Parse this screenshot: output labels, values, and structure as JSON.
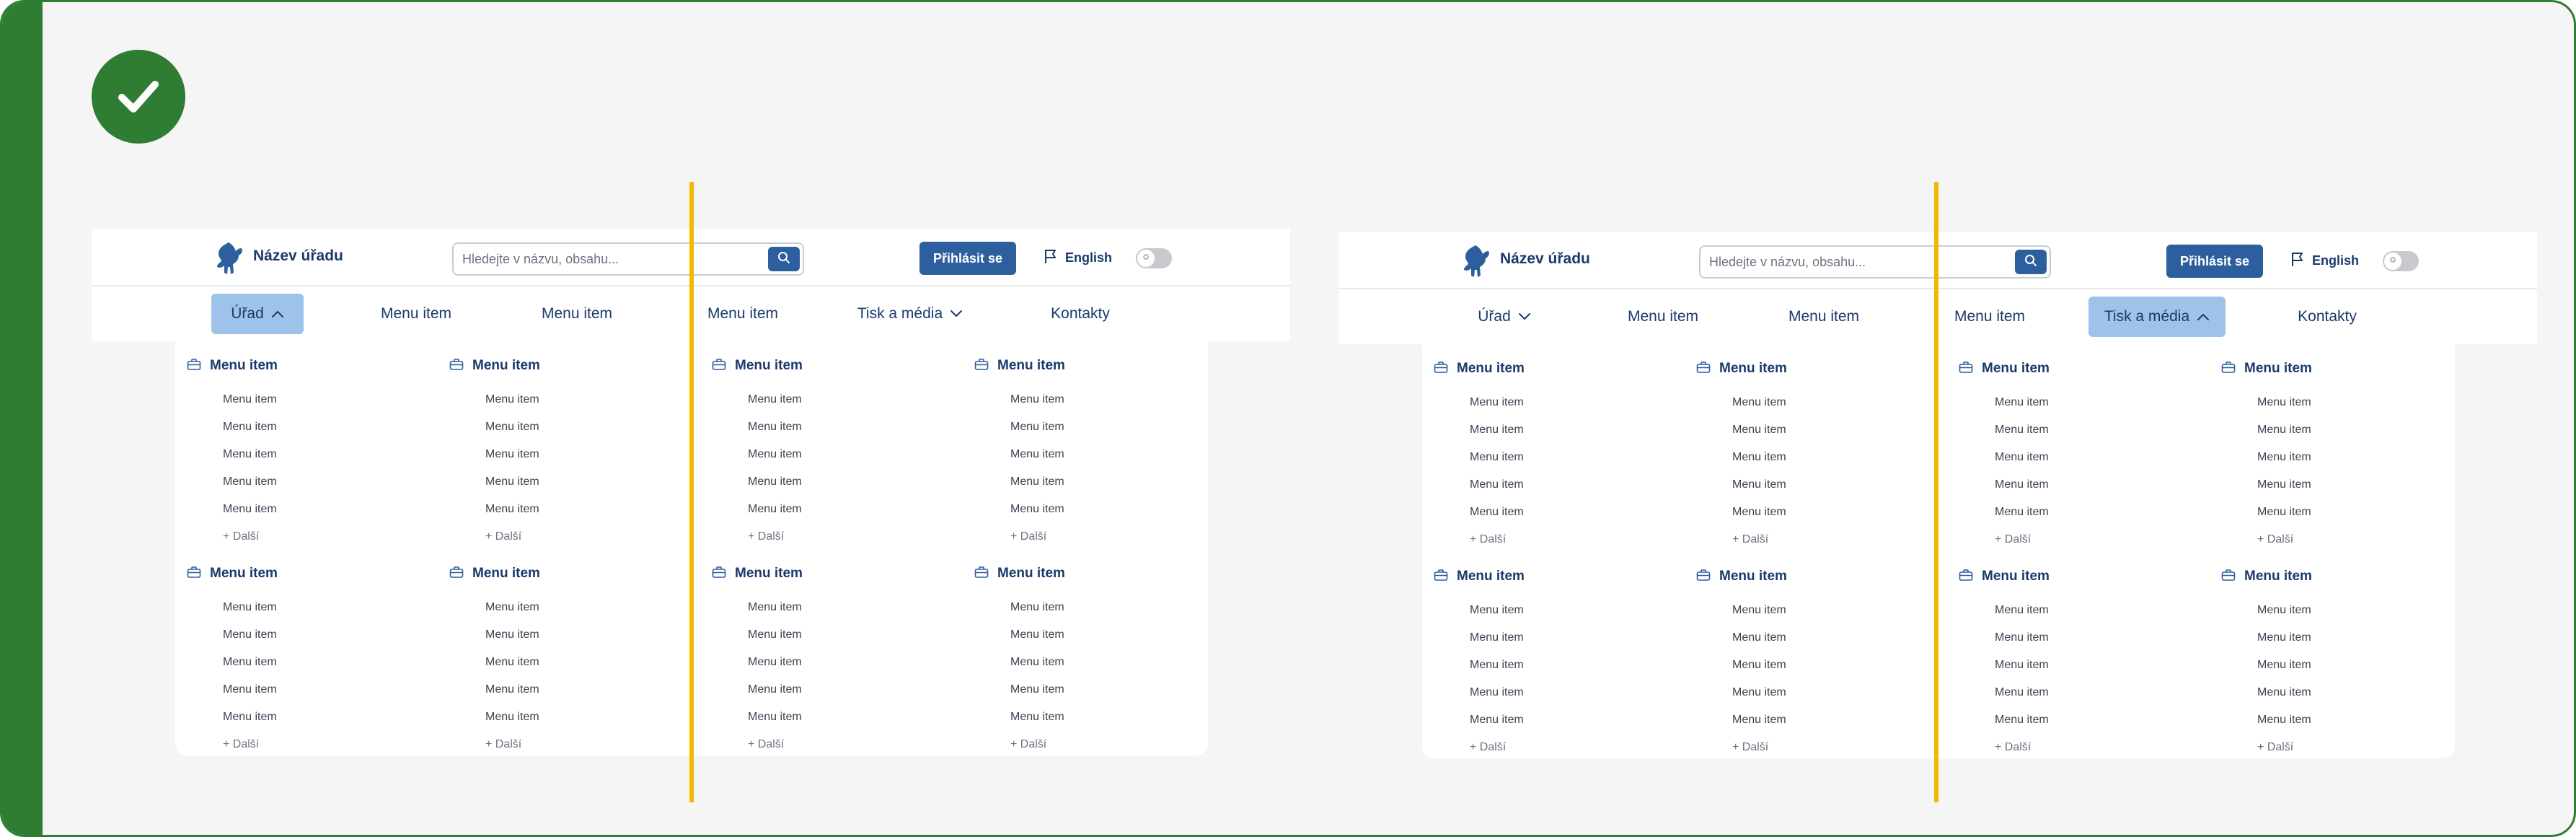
{
  "colors": {
    "frame_green": "#2e7d32",
    "primary": "#2d5f9e",
    "active_nav": "#9ec3ea",
    "guide_yellow": "#f5b800",
    "text_dark": "#1b3a6b"
  },
  "icons": {
    "status": "check-icon",
    "logo": "lion-emblem-icon",
    "search": "search-icon",
    "language": "flag-icon",
    "group": "briefcase-icon",
    "chevron_up": "chevron-up-icon",
    "chevron_down": "chevron-down-icon"
  },
  "examples": [
    {
      "header": {
        "org_name": "Název úřadu",
        "search_placeholder": "Hledejte v názvu, obsahu...",
        "login_label": "Přihlásit se",
        "language_label": "English"
      },
      "nav": [
        {
          "label": "Úřad",
          "chevron": "up",
          "active": true
        },
        {
          "label": "Menu item"
        },
        {
          "label": "Menu item"
        },
        {
          "label": "Menu item"
        },
        {
          "label": "Tisk a média",
          "chevron": "down",
          "active": false
        },
        {
          "label": "Kontakty"
        }
      ],
      "groups": [
        {
          "title": "Menu item",
          "items": [
            "Menu item",
            "Menu item",
            "Menu item",
            "Menu item",
            "Menu item"
          ],
          "more": "+ Další"
        },
        {
          "title": "Menu item",
          "items": [
            "Menu item",
            "Menu item",
            "Menu item",
            "Menu item",
            "Menu item"
          ],
          "more": "+ Další"
        },
        {
          "title": "Menu item",
          "items": [
            "Menu item",
            "Menu item",
            "Menu item",
            "Menu item",
            "Menu item"
          ],
          "more": "+ Další"
        },
        {
          "title": "Menu item",
          "items": [
            "Menu item",
            "Menu item",
            "Menu item",
            "Menu item",
            "Menu item"
          ],
          "more": "+ Další"
        },
        {
          "title": "Menu item",
          "items": [
            "Menu item",
            "Menu item",
            "Menu item",
            "Menu item",
            "Menu item"
          ],
          "more": "+ Další"
        },
        {
          "title": "Menu item",
          "items": [
            "Menu item",
            "Menu item",
            "Menu item",
            "Menu item",
            "Menu item"
          ],
          "more": "+ Další"
        },
        {
          "title": "Menu item",
          "items": [
            "Menu item",
            "Menu item",
            "Menu item",
            "Menu item",
            "Menu item"
          ],
          "more": "+ Další"
        },
        {
          "title": "Menu item",
          "items": [
            "Menu item",
            "Menu item",
            "Menu item",
            "Menu item",
            "Menu item"
          ],
          "more": "+ Další"
        }
      ]
    },
    {
      "header": {
        "org_name": "Název úřadu",
        "search_placeholder": "Hledejte v názvu, obsahu...",
        "login_label": "Přihlásit se",
        "language_label": "English"
      },
      "nav": [
        {
          "label": "Úřad",
          "chevron": "down",
          "active": false
        },
        {
          "label": "Menu item"
        },
        {
          "label": "Menu item"
        },
        {
          "label": "Menu item"
        },
        {
          "label": "Tisk a média",
          "chevron": "up",
          "active": true
        },
        {
          "label": "Kontakty"
        }
      ],
      "groups": [
        {
          "title": "Menu item",
          "items": [
            "Menu item",
            "Menu item",
            "Menu item",
            "Menu item",
            "Menu item"
          ],
          "more": "+ Další"
        },
        {
          "title": "Menu item",
          "items": [
            "Menu item",
            "Menu item",
            "Menu item",
            "Menu item",
            "Menu item"
          ],
          "more": "+ Další"
        },
        {
          "title": "Menu item",
          "items": [
            "Menu item",
            "Menu item",
            "Menu item",
            "Menu item",
            "Menu item"
          ],
          "more": "+ Další"
        },
        {
          "title": "Menu item",
          "items": [
            "Menu item",
            "Menu item",
            "Menu item",
            "Menu item",
            "Menu item"
          ],
          "more": "+ Další"
        },
        {
          "title": "Menu item",
          "items": [
            "Menu item",
            "Menu item",
            "Menu item",
            "Menu item",
            "Menu item"
          ],
          "more": "+ Další"
        },
        {
          "title": "Menu item",
          "items": [
            "Menu item",
            "Menu item",
            "Menu item",
            "Menu item",
            "Menu item"
          ],
          "more": "+ Další"
        },
        {
          "title": "Menu item",
          "items": [
            "Menu item",
            "Menu item",
            "Menu item",
            "Menu item",
            "Menu item"
          ],
          "more": "+ Další"
        },
        {
          "title": "Menu item",
          "items": [
            "Menu item",
            "Menu item",
            "Menu item",
            "Menu item",
            "Menu item"
          ],
          "more": "+ Další"
        }
      ]
    }
  ]
}
